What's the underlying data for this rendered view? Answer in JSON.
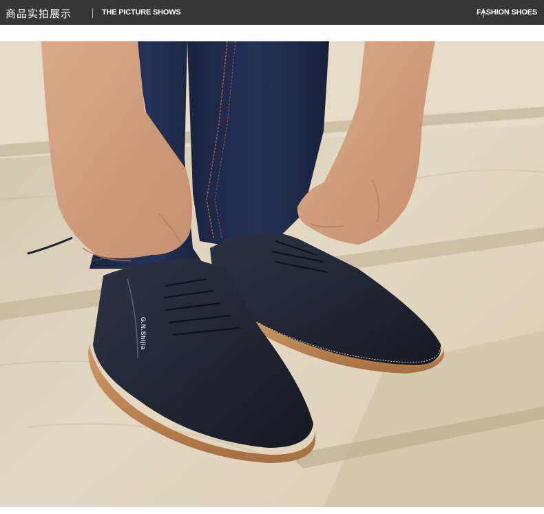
{
  "header": {
    "left_cn": "商品实拍展示",
    "left_en": "THE PICTURE SHOWS",
    "right_en": "FASHION SHOES"
  },
  "photo": {
    "logo_text": "G.N.Shijia",
    "icons": [
      "shoe-photo",
      "hand-left",
      "hand-right",
      "jeans",
      "shoe-left",
      "shoe-right",
      "shoelace"
    ]
  },
  "colors": {
    "header_bg": "#363636",
    "header_text": "#ffffff",
    "stone": "#dfd3bb",
    "jeans": "#1f2a47",
    "leather": "#1d2432",
    "sole": "#c48a57",
    "skin": "#d7a584"
  }
}
